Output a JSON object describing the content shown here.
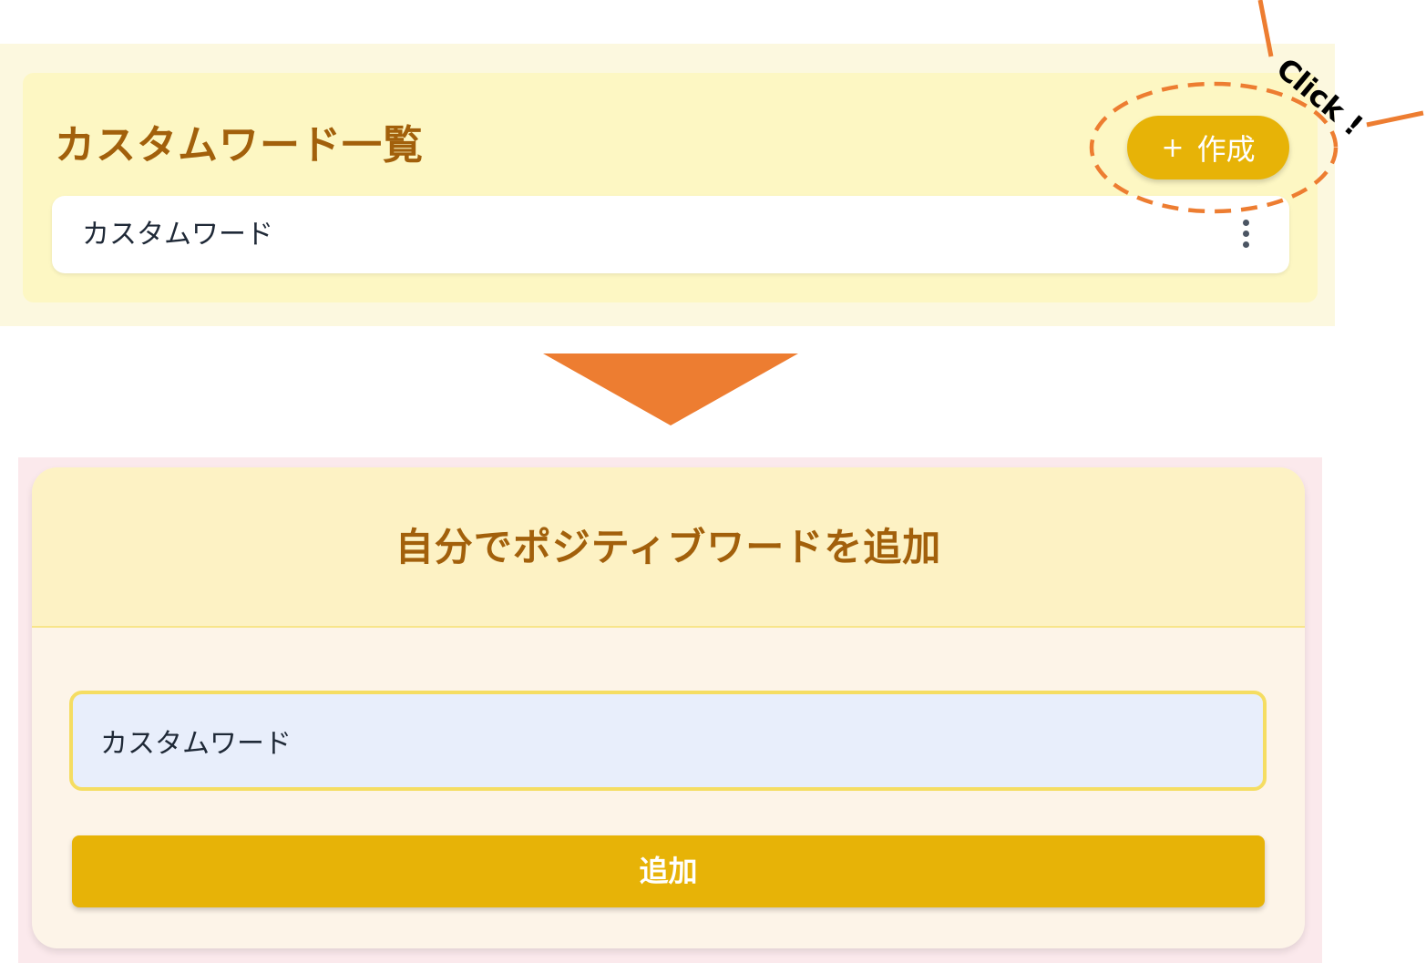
{
  "top_panel": {
    "title": "カスタムワード一覧",
    "create_button": {
      "icon": "plus-icon",
      "icon_glyph": "+",
      "label": "作成"
    },
    "word_list": [
      {
        "label": "カスタムワード",
        "menu_icon": "more-vertical-icon"
      }
    ]
  },
  "annotation": {
    "click_text": "Click !"
  },
  "dialog": {
    "title": "自分でポジティブワードを追加",
    "input": {
      "value": "カスタムワード"
    },
    "add_button_label": "追加"
  },
  "colors": {
    "brand_gold": "#e7b307",
    "title_brown": "#a2600b",
    "annotation_orange": "#ed7d31",
    "input_border": "#f5dd62"
  }
}
